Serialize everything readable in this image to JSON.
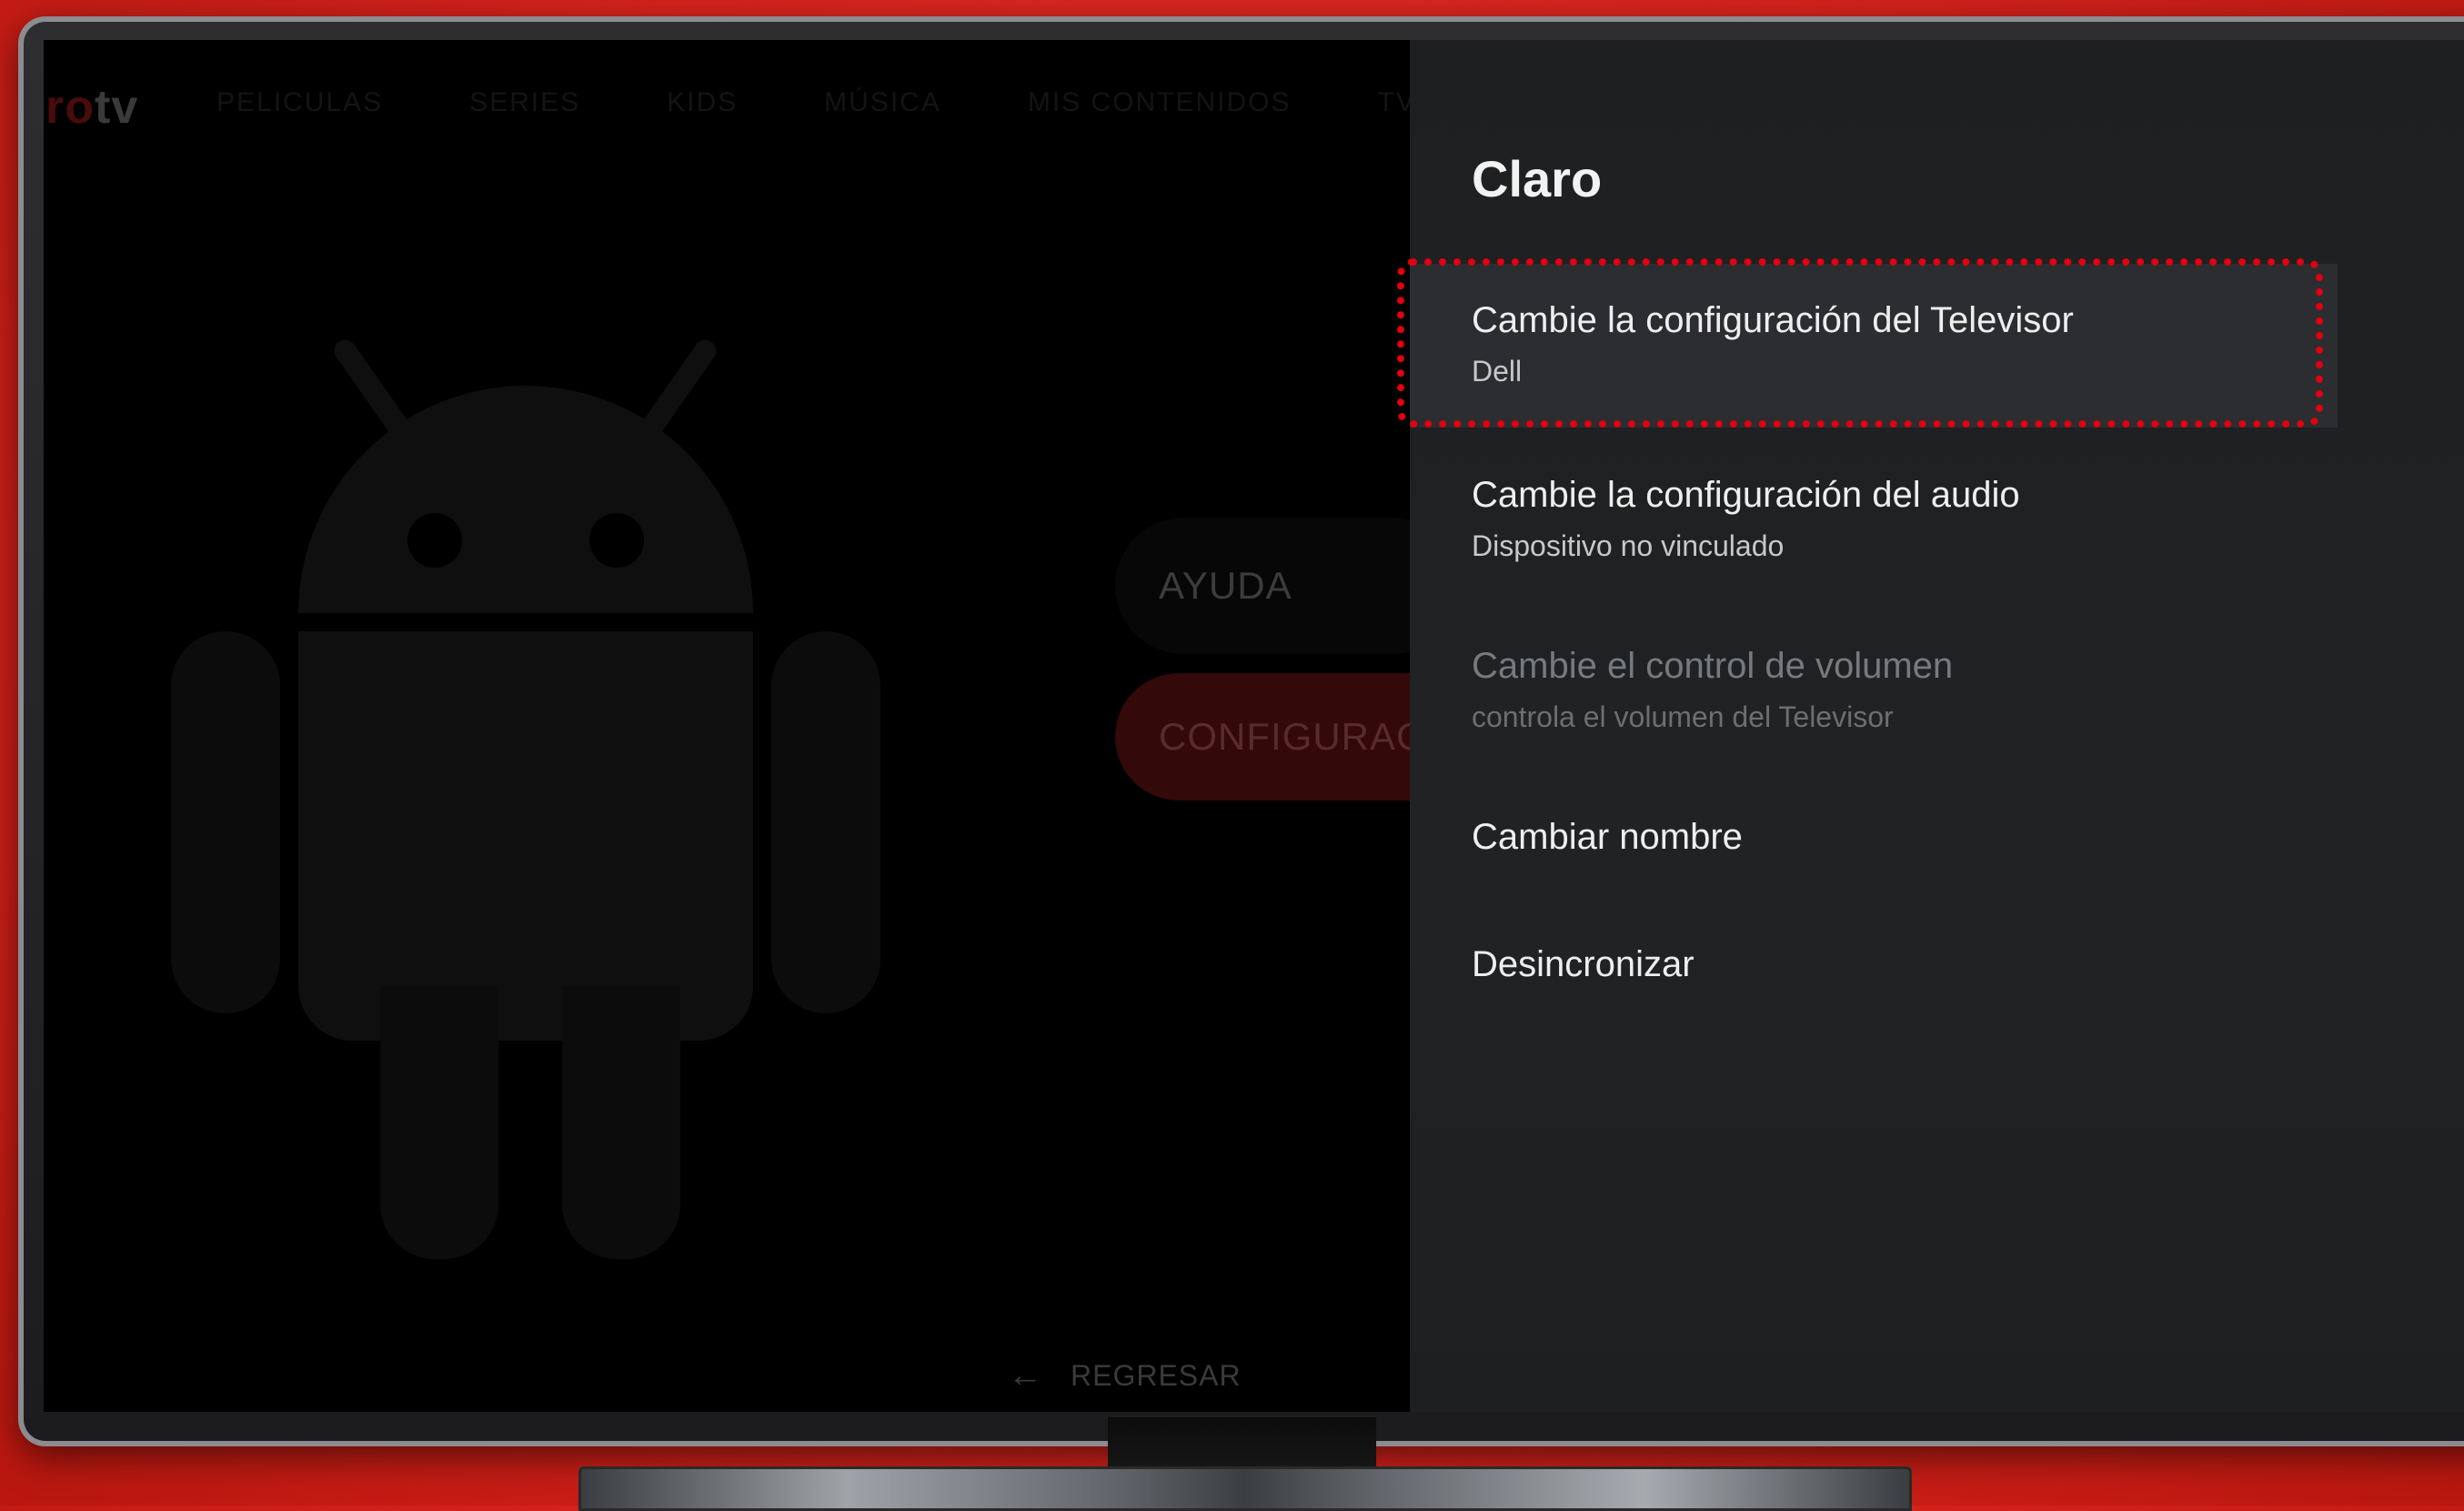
{
  "app": {
    "logo_red": "ro",
    "logo_brand": "tv",
    "nav_items": [
      "PELICULAS",
      "SERIES",
      "KIDS",
      "MÚSICA",
      "MIS CONTENIDOS",
      "TV EN VIVO"
    ],
    "help_button": "AYUDA",
    "config_button": "CONFIGURACIÓN",
    "back_label": "REGRESAR"
  },
  "panel": {
    "title": "Claro",
    "items": [
      {
        "label": "Cambie la configuración del Televisor",
        "sub": "Dell",
        "state": "focused"
      },
      {
        "label": "Cambie la configuración del audio",
        "sub": "Dispositivo no vinculado",
        "state": "normal"
      },
      {
        "label": "Cambie el control de volumen",
        "sub": "controla el volumen del Televisor",
        "state": "disabled"
      },
      {
        "label": "Cambiar nombre",
        "state": "normal"
      },
      {
        "label": "Desincronizar",
        "state": "normal"
      }
    ]
  },
  "colors": {
    "background_red": "#d8241d",
    "focus_ring": "#e0000f",
    "panel_bg": "#1f2123"
  }
}
